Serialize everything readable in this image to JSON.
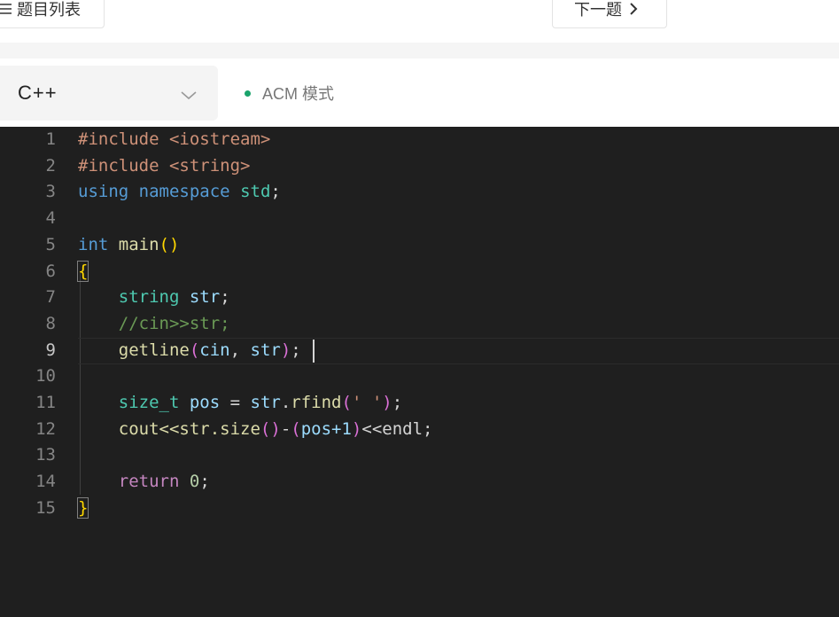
{
  "nav": {
    "list_label": "题目列表",
    "next_label": "下一题",
    "list_icon": "menu-icon",
    "next_icon": "chevron-right-icon"
  },
  "editor_bar": {
    "language": "C++",
    "mode": "ACM 模式",
    "mode_dot_color": "#1aa36b"
  },
  "editor": {
    "active_line": 9,
    "line_numbers": [
      "1",
      "2",
      "3",
      "4",
      "5",
      "6",
      "7",
      "8",
      "9",
      "10",
      "11",
      "12",
      "13",
      "14",
      "15"
    ],
    "lines": [
      [
        [
          "#include <iostream>",
          "str"
        ]
      ],
      [
        [
          "#include <string>",
          "str"
        ]
      ],
      [
        [
          "using",
          "kw-blue"
        ],
        [
          " ",
          ""
        ],
        [
          "namespace",
          "kw-blue"
        ],
        [
          " ",
          ""
        ],
        [
          "std",
          "type"
        ],
        [
          ";",
          ""
        ]
      ],
      [],
      [
        [
          "int",
          "kw-blue"
        ],
        [
          " ",
          ""
        ],
        [
          "main",
          "fn"
        ],
        [
          "()",
          "br1"
        ]
      ],
      [
        [
          "{",
          "br1 brace-box"
        ]
      ],
      [
        [
          "    ",
          ""
        ],
        [
          "string",
          "type"
        ],
        [
          " ",
          ""
        ],
        [
          "str",
          "var"
        ],
        [
          ";",
          ""
        ]
      ],
      [
        [
          "    ",
          ""
        ],
        [
          "//cin>>str;",
          "cmt"
        ]
      ],
      [
        [
          "    ",
          ""
        ],
        [
          "getline",
          "fn"
        ],
        [
          "(",
          "br2"
        ],
        [
          "cin",
          "var"
        ],
        [
          ", ",
          ""
        ],
        [
          "str",
          "var"
        ],
        [
          ")",
          "br2"
        ],
        [
          ";",
          ""
        ]
      ],
      [],
      [
        [
          "    ",
          ""
        ],
        [
          "size_t",
          "type"
        ],
        [
          " ",
          ""
        ],
        [
          "pos",
          "var"
        ],
        [
          " = ",
          ""
        ],
        [
          "str",
          "var"
        ],
        [
          ".",
          ""
        ],
        [
          "rfind",
          "fn"
        ],
        [
          "(",
          "br2"
        ],
        [
          "' '",
          "str"
        ],
        [
          ")",
          "br2"
        ],
        [
          ";",
          ""
        ]
      ],
      [
        [
          "    ",
          ""
        ],
        [
          "cout<<str.size",
          "fn"
        ],
        [
          "()",
          "br2"
        ],
        [
          "-",
          ""
        ],
        [
          "(",
          "br2"
        ],
        [
          "pos+1",
          "var"
        ],
        [
          ")",
          "br2"
        ],
        [
          "<<endl;",
          ""
        ]
      ],
      [],
      [
        [
          "    ",
          ""
        ],
        [
          "return",
          "kw-ctl"
        ],
        [
          " ",
          ""
        ],
        [
          "0",
          "num"
        ],
        [
          ";",
          ""
        ]
      ],
      [
        [
          "}",
          "br1 brace-box"
        ]
      ]
    ]
  }
}
